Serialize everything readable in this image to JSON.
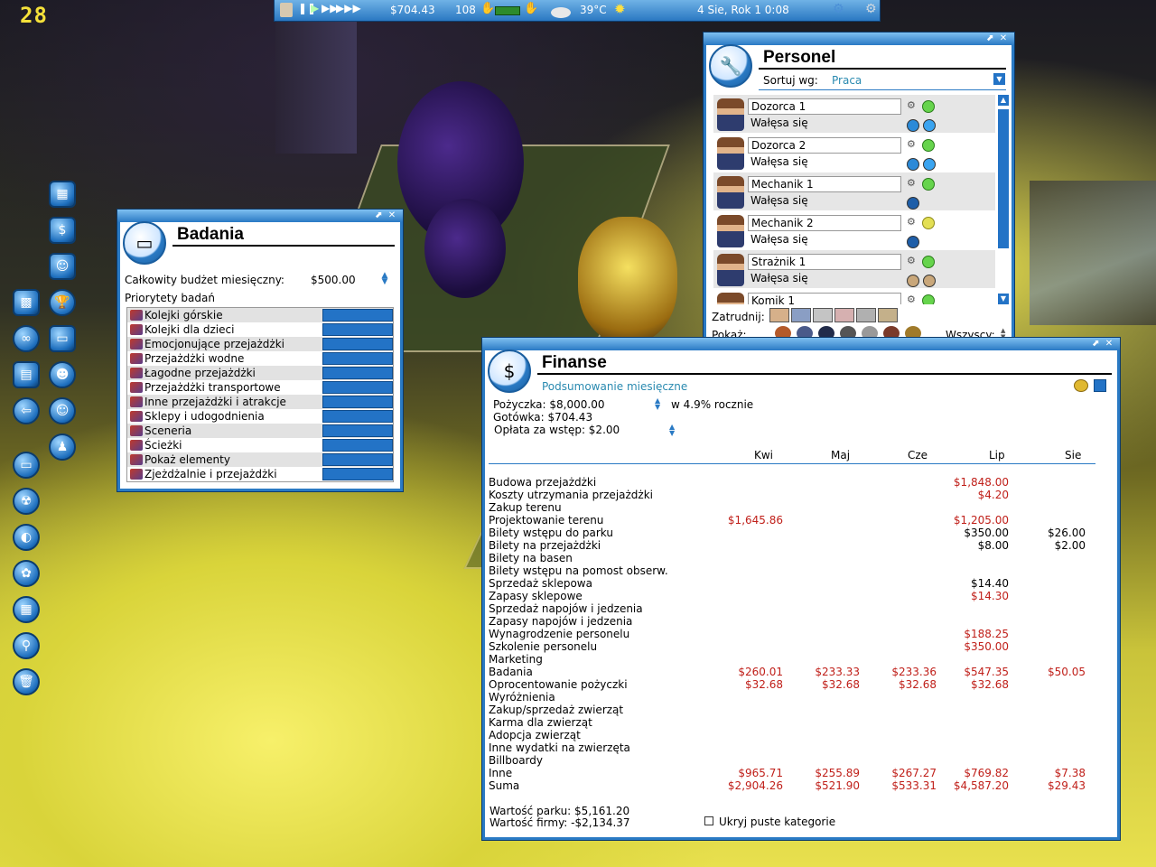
{
  "hud": {
    "fps": "28",
    "money": "$704.43",
    "guests": "108",
    "temperature": "39°C",
    "date": "4 Sie, Rok 1  0:08"
  },
  "badania": {
    "title": "Badania",
    "budget_label": "Całkowity budżet miesięczny:",
    "budget_value": "$500.00",
    "priorities_label": "Priorytety badań",
    "categories": [
      "Kolejki górskie",
      "Kolejki dla dzieci",
      "Emocjonujące przejażdżki",
      "Przejażdżki wodne",
      "Łagodne przejażdżki",
      "Przejażdżki transportowe",
      "Inne przejażdżki i atrakcje",
      "Sklepy i udogodnienia",
      "Sceneria",
      "Ścieżki",
      "Pokaż elementy",
      "Zjeżdżalnie i przejażdżki"
    ]
  },
  "personel": {
    "title": "Personel",
    "sort_label": "Sortuj wg:",
    "sort_value": "Praca",
    "staff": [
      {
        "name": "Dozorca 1",
        "status": "Wałęsa się",
        "mood": "happy",
        "dot1": "#2b8ad8",
        "dot2": "#3aa4f0"
      },
      {
        "name": "Dozorca 2",
        "status": "Wałęsa się",
        "mood": "happy",
        "dot1": "#2b8ad8",
        "dot2": "#3aa4f0"
      },
      {
        "name": "Mechanik 1",
        "status": "Wałęsa się",
        "mood": "happy",
        "dot1": "#1e5ea8",
        "dot2": ""
      },
      {
        "name": "Mechanik 2",
        "status": "Wałęsa się",
        "mood": "neutral",
        "dot1": "#1e5ea8",
        "dot2": ""
      },
      {
        "name": "Strażnik 1",
        "status": "Wałęsa się",
        "mood": "happy",
        "dot1": "#c9a77a",
        "dot2": "#c9a77a"
      },
      {
        "name": "Komik 1",
        "status": "",
        "mood": "happy",
        "dot1": "",
        "dot2": ""
      }
    ],
    "hire_label": "Zatrudnij:",
    "show_label": "Pokaż:",
    "all_label": "Wszyscy:"
  },
  "finanse": {
    "title": "Finanse",
    "subtitle": "Podsumowanie miesięczne",
    "loan_label": "Pożyczka: $8,000.00",
    "loan_rate": "w 4.9% rocznie",
    "cash_label": "Gotówka: $704.43",
    "entry_fee_label": "Opłata za wstęp: $2.00",
    "months": [
      "Kwi",
      "Maj",
      "Cze",
      "Lip",
      "Sie"
    ],
    "rows": [
      {
        "label": "Budowa przejażdżki",
        "values": [
          "",
          "",
          "",
          "$1,848.00",
          ""
        ],
        "colors": [
          "",
          "",
          "",
          "red",
          ""
        ]
      },
      {
        "label": "Koszty utrzymania przejażdżki",
        "values": [
          "",
          "",
          "",
          "$4.20",
          ""
        ],
        "colors": [
          "",
          "",
          "",
          "red",
          ""
        ]
      },
      {
        "label": "Zakup terenu",
        "values": [
          "",
          "",
          "",
          "",
          ""
        ],
        "colors": [
          "",
          "",
          "",
          "",
          ""
        ]
      },
      {
        "label": "Projektowanie terenu",
        "values": [
          "$1,645.86",
          "",
          "",
          "$1,205.00",
          ""
        ],
        "colors": [
          "red",
          "",
          "",
          "red",
          ""
        ]
      },
      {
        "label": "Bilety wstępu do parku",
        "values": [
          "",
          "",
          "",
          "$350.00",
          "$26.00"
        ],
        "colors": [
          "",
          "",
          "",
          "blk",
          "blk"
        ]
      },
      {
        "label": "Bilety na przejażdżki",
        "values": [
          "",
          "",
          "",
          "$8.00",
          "$2.00"
        ],
        "colors": [
          "",
          "",
          "",
          "blk",
          "blk"
        ]
      },
      {
        "label": "Bilety na basen",
        "values": [
          "",
          "",
          "",
          "",
          ""
        ],
        "colors": [
          "",
          "",
          "",
          "",
          ""
        ]
      },
      {
        "label": "Bilety wstępu na pomost obserw.",
        "values": [
          "",
          "",
          "",
          "",
          ""
        ],
        "colors": [
          "",
          "",
          "",
          "",
          ""
        ]
      },
      {
        "label": "Sprzedaż sklepowa",
        "values": [
          "",
          "",
          "",
          "$14.40",
          ""
        ],
        "colors": [
          "",
          "",
          "",
          "blk",
          ""
        ]
      },
      {
        "label": "Zapasy sklepowe",
        "values": [
          "",
          "",
          "",
          "$14.30",
          ""
        ],
        "colors": [
          "",
          "",
          "",
          "red",
          ""
        ]
      },
      {
        "label": "Sprzedaż napojów i jedzenia",
        "values": [
          "",
          "",
          "",
          "",
          ""
        ],
        "colors": [
          "",
          "",
          "",
          "",
          ""
        ]
      },
      {
        "label": "Zapasy napojów i jedzenia",
        "values": [
          "",
          "",
          "",
          "",
          ""
        ],
        "colors": [
          "",
          "",
          "",
          "",
          ""
        ]
      },
      {
        "label": "Wynagrodzenie personelu",
        "values": [
          "",
          "",
          "",
          "$188.25",
          ""
        ],
        "colors": [
          "",
          "",
          "",
          "red",
          ""
        ]
      },
      {
        "label": "Szkolenie personelu",
        "values": [
          "",
          "",
          "",
          "$350.00",
          ""
        ],
        "colors": [
          "",
          "",
          "",
          "red",
          ""
        ]
      },
      {
        "label": "Marketing",
        "values": [
          "",
          "",
          "",
          "",
          ""
        ],
        "colors": [
          "",
          "",
          "",
          "",
          ""
        ]
      },
      {
        "label": "Badania",
        "values": [
          "$260.01",
          "$233.33",
          "$233.36",
          "$547.35",
          "$50.05"
        ],
        "colors": [
          "red",
          "red",
          "red",
          "red",
          "red"
        ]
      },
      {
        "label": "Oprocentowanie pożyczki",
        "values": [
          "$32.68",
          "$32.68",
          "$32.68",
          "$32.68",
          ""
        ],
        "colors": [
          "red",
          "red",
          "red",
          "red",
          ""
        ]
      },
      {
        "label": "Wyróżnienia",
        "values": [
          "",
          "",
          "",
          "",
          ""
        ],
        "colors": [
          "",
          "",
          "",
          "",
          ""
        ]
      },
      {
        "label": "Zakup/sprzedaż zwierząt",
        "values": [
          "",
          "",
          "",
          "",
          ""
        ],
        "colors": [
          "",
          "",
          "",
          "",
          ""
        ]
      },
      {
        "label": "Karma dla zwierząt",
        "values": [
          "",
          "",
          "",
          "",
          ""
        ],
        "colors": [
          "",
          "",
          "",
          "",
          ""
        ]
      },
      {
        "label": "Adopcja zwierząt",
        "values": [
          "",
          "",
          "",
          "",
          ""
        ],
        "colors": [
          "",
          "",
          "",
          "",
          ""
        ]
      },
      {
        "label": "Inne wydatki na zwierzęta",
        "values": [
          "",
          "",
          "",
          "",
          ""
        ],
        "colors": [
          "",
          "",
          "",
          "",
          ""
        ]
      },
      {
        "label": "Billboardy",
        "values": [
          "",
          "",
          "",
          "",
          ""
        ],
        "colors": [
          "",
          "",
          "",
          "",
          ""
        ]
      },
      {
        "label": "Inne",
        "values": [
          "$965.71",
          "$255.89",
          "$267.27",
          "$769.82",
          "$7.38"
        ],
        "colors": [
          "red",
          "red",
          "red",
          "red",
          "red"
        ]
      },
      {
        "label": "Suma",
        "values": [
          "$2,904.26",
          "$521.90",
          "$533.31",
          "$4,587.20",
          "$29.43"
        ],
        "colors": [
          "red",
          "red",
          "red",
          "red",
          "red"
        ]
      }
    ],
    "park_value": "Wartość parku: $5,161.20",
    "company_value": "Wartość firmy: -$2,134.37",
    "hide_empty_label": "Ukryj puste kategorie"
  }
}
